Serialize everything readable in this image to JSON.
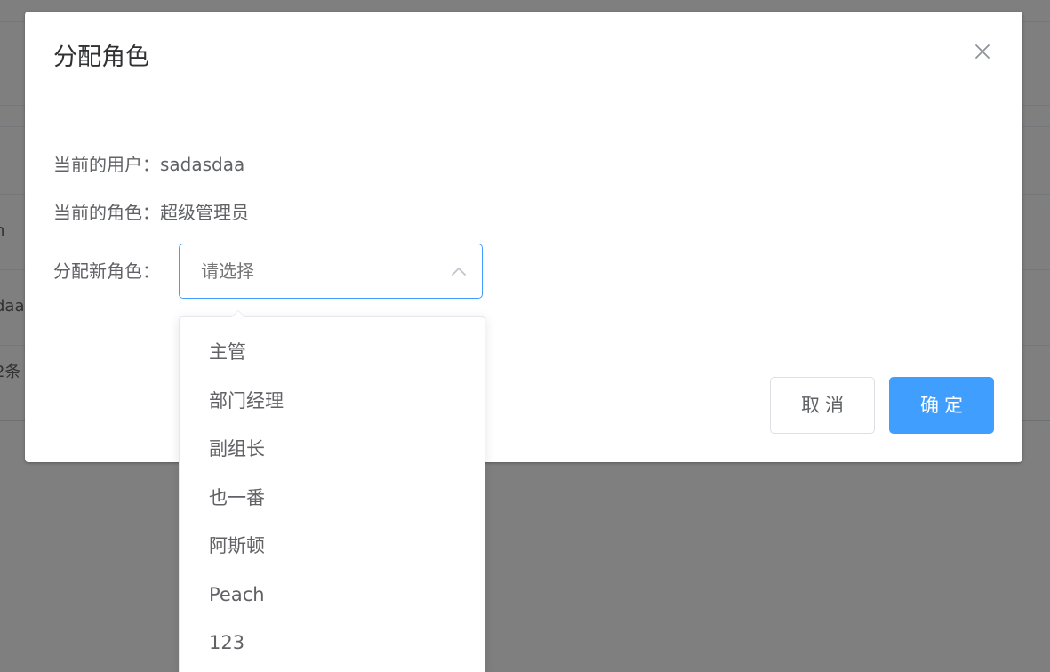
{
  "background": {
    "rows": [
      "n",
      "daa",
      "2条"
    ]
  },
  "dialog": {
    "title": "分配角色",
    "close_icon": "close-icon",
    "current_user_label": "当前的用户：",
    "current_user_value": "sadasdaa",
    "current_role_label": "当前的角色：",
    "current_role_value": "超级管理员",
    "new_role_label": "分配新角色：",
    "select_placeholder": "请选择",
    "cancel_label": "取消",
    "confirm_label": "确定"
  },
  "dropdown": {
    "options": [
      "主管",
      "部门经理",
      "副组长",
      "也一番",
      "阿斯顿",
      "Peach",
      "123"
    ]
  },
  "colors": {
    "primary": "#409eff",
    "text_regular": "#606266",
    "text_primary": "#303133",
    "placeholder": "#c0c4cc"
  }
}
